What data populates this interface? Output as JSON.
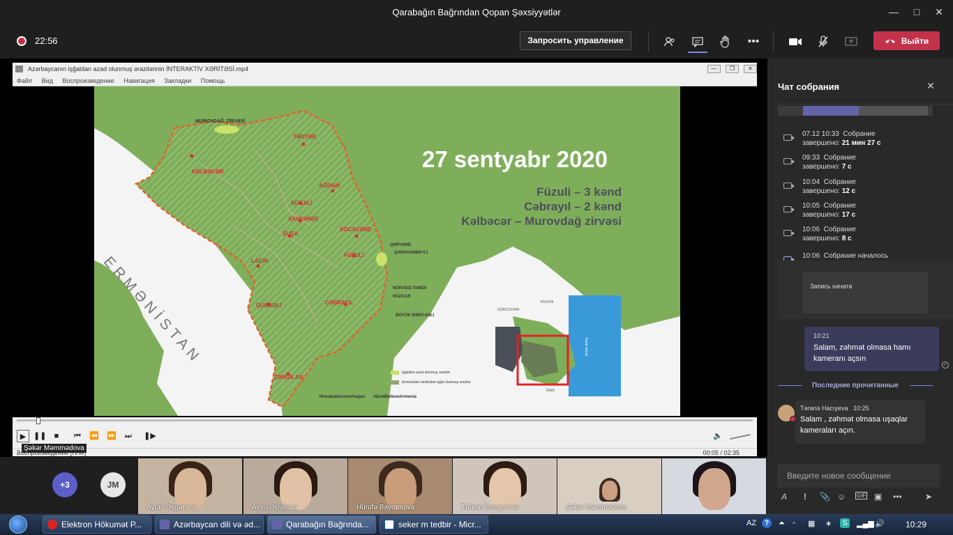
{
  "window": {
    "title": "Qarabağın Bağrından Qopan Şəxsiyyətlər"
  },
  "toolbar": {
    "timer": "22:56",
    "request_control": "Запросить управление",
    "leave": "Выйти"
  },
  "player": {
    "file_title": "Azərbaycanın işğaldan azad olunmuş ərazilərinin İNTERAKTİV XƏRİTƏSİ.mp4",
    "menu": [
      "Файл",
      "Вид",
      "Воспроизведение",
      "Навигация",
      "Закладки",
      "Помощь"
    ],
    "status": "Воспроизведение [H/W]",
    "time": "00:05 / 02:35",
    "presenter": "Şəkər Məmmədova"
  },
  "map": {
    "date": "27 sentyabr 2020",
    "line1": "Füzuli – 3 kənd",
    "line2": "Cəbrayıl – 2 kənd",
    "line3": "Kəlbəcər – Murovdağ zirvəsi",
    "country": "ERMƏNİSTAN",
    "places": {
      "murovdag": "MUROVDAĞ ZİRVƏSİ",
      "terter": "TƏRTƏR",
      "kelbecer": "KƏLBƏCƏR",
      "agdam": "AĞDAM",
      "xocali": "XOCALI",
      "xankendi": "XANKƏNDİ",
      "susa": "ŞUŞA",
      "xocavend": "XOCAVƏND",
      "lacin": "LAÇIN",
      "fuzuli": "FÜZULİ",
      "qubadli": "QUBADLI",
      "cebrayil": "CƏBRAYIL",
      "zengilan": "ZƏNGİLAN",
      "qervend": "QƏRVƏND",
      "qaraxanbeyli": "QARAXANBƏYLİ",
      "horadiz": "NORADİZ KƏNDİ",
      "nuzgar": "NÜZGAR",
      "boyukmercanli": "BÖYÜK MƏRCANLI"
    },
    "legend1": "İşğaldan azad olunmuş ərazilər",
    "legend2": "Ermənistan tərəfindən işğal olunmuş ərazilər",
    "hashtag1": "#KarabakhisAzerbaijan",
    "hashtag2": "#DontBelieveArmenia",
    "inset_russia": "RUSİYA",
    "inset_georgia": "GÜRCÜSTAN",
    "inset_iran": "İRAN",
    "inset_sea": "Xəzər dənizi"
  },
  "participants": {
    "overflow": "+3",
    "initials": "JM",
    "tiles": [
      {
        "name": "Aytac Əsgərova"
      },
      {
        "name": "Aysu Əşrəfova"
      },
      {
        "name": "Hürufə Bayramova"
      },
      {
        "name": "Türkan İsmayılova"
      },
      {
        "name": "Şəkər Məmmədova"
      },
      {
        "name": ""
      }
    ]
  },
  "chat": {
    "title": "Чат собрания",
    "events": [
      {
        "time": "07.12 10:33",
        "label": "Собрание",
        "line2": "завершено:",
        "duration": "21 мин 27 с"
      },
      {
        "time": "09:33",
        "label": "Собрание",
        "line2": "завершено:",
        "duration": "7 с"
      },
      {
        "time": "10:04",
        "label": "Собрание",
        "line2": "завершено:",
        "duration": "12 с"
      },
      {
        "time": "10:05",
        "label": "Собрание",
        "line2": "завершено:",
        "duration": "17 с"
      },
      {
        "time": "10:06",
        "label": "Собрание",
        "line2": "завершено:",
        "duration": "8 с"
      },
      {
        "time": "10:06",
        "label": "Собрание началось",
        "line2": "",
        "duration": ""
      }
    ],
    "recording": "Запись начата",
    "own_message": {
      "time": "10:21",
      "text": "Salam, zəhmət olmasa hamı kameranı açsın"
    },
    "last_read": "Последние прочитанные",
    "other_message": {
      "author": "Təranə Hacıyeva",
      "time": "10:25",
      "text": "Salam , zəhmət olmasa uşaqlar kameraları açın."
    },
    "compose_placeholder": "Введите новое сообщение"
  },
  "taskbar": {
    "items": [
      {
        "label": "Elektron Hökumət P..."
      },
      {
        "label": "Azərbaycan dili və əd..."
      },
      {
        "label": "Qarabağın Bağrında..."
      },
      {
        "label": "seker m tedbir - Micr..."
      }
    ],
    "lang": "AZ",
    "clock": "10:29"
  },
  "colors": {
    "leave": "#c4314b",
    "accent": "#6264a7",
    "map_green": "#7fae5b",
    "occupied_orange": "#e2622a"
  }
}
